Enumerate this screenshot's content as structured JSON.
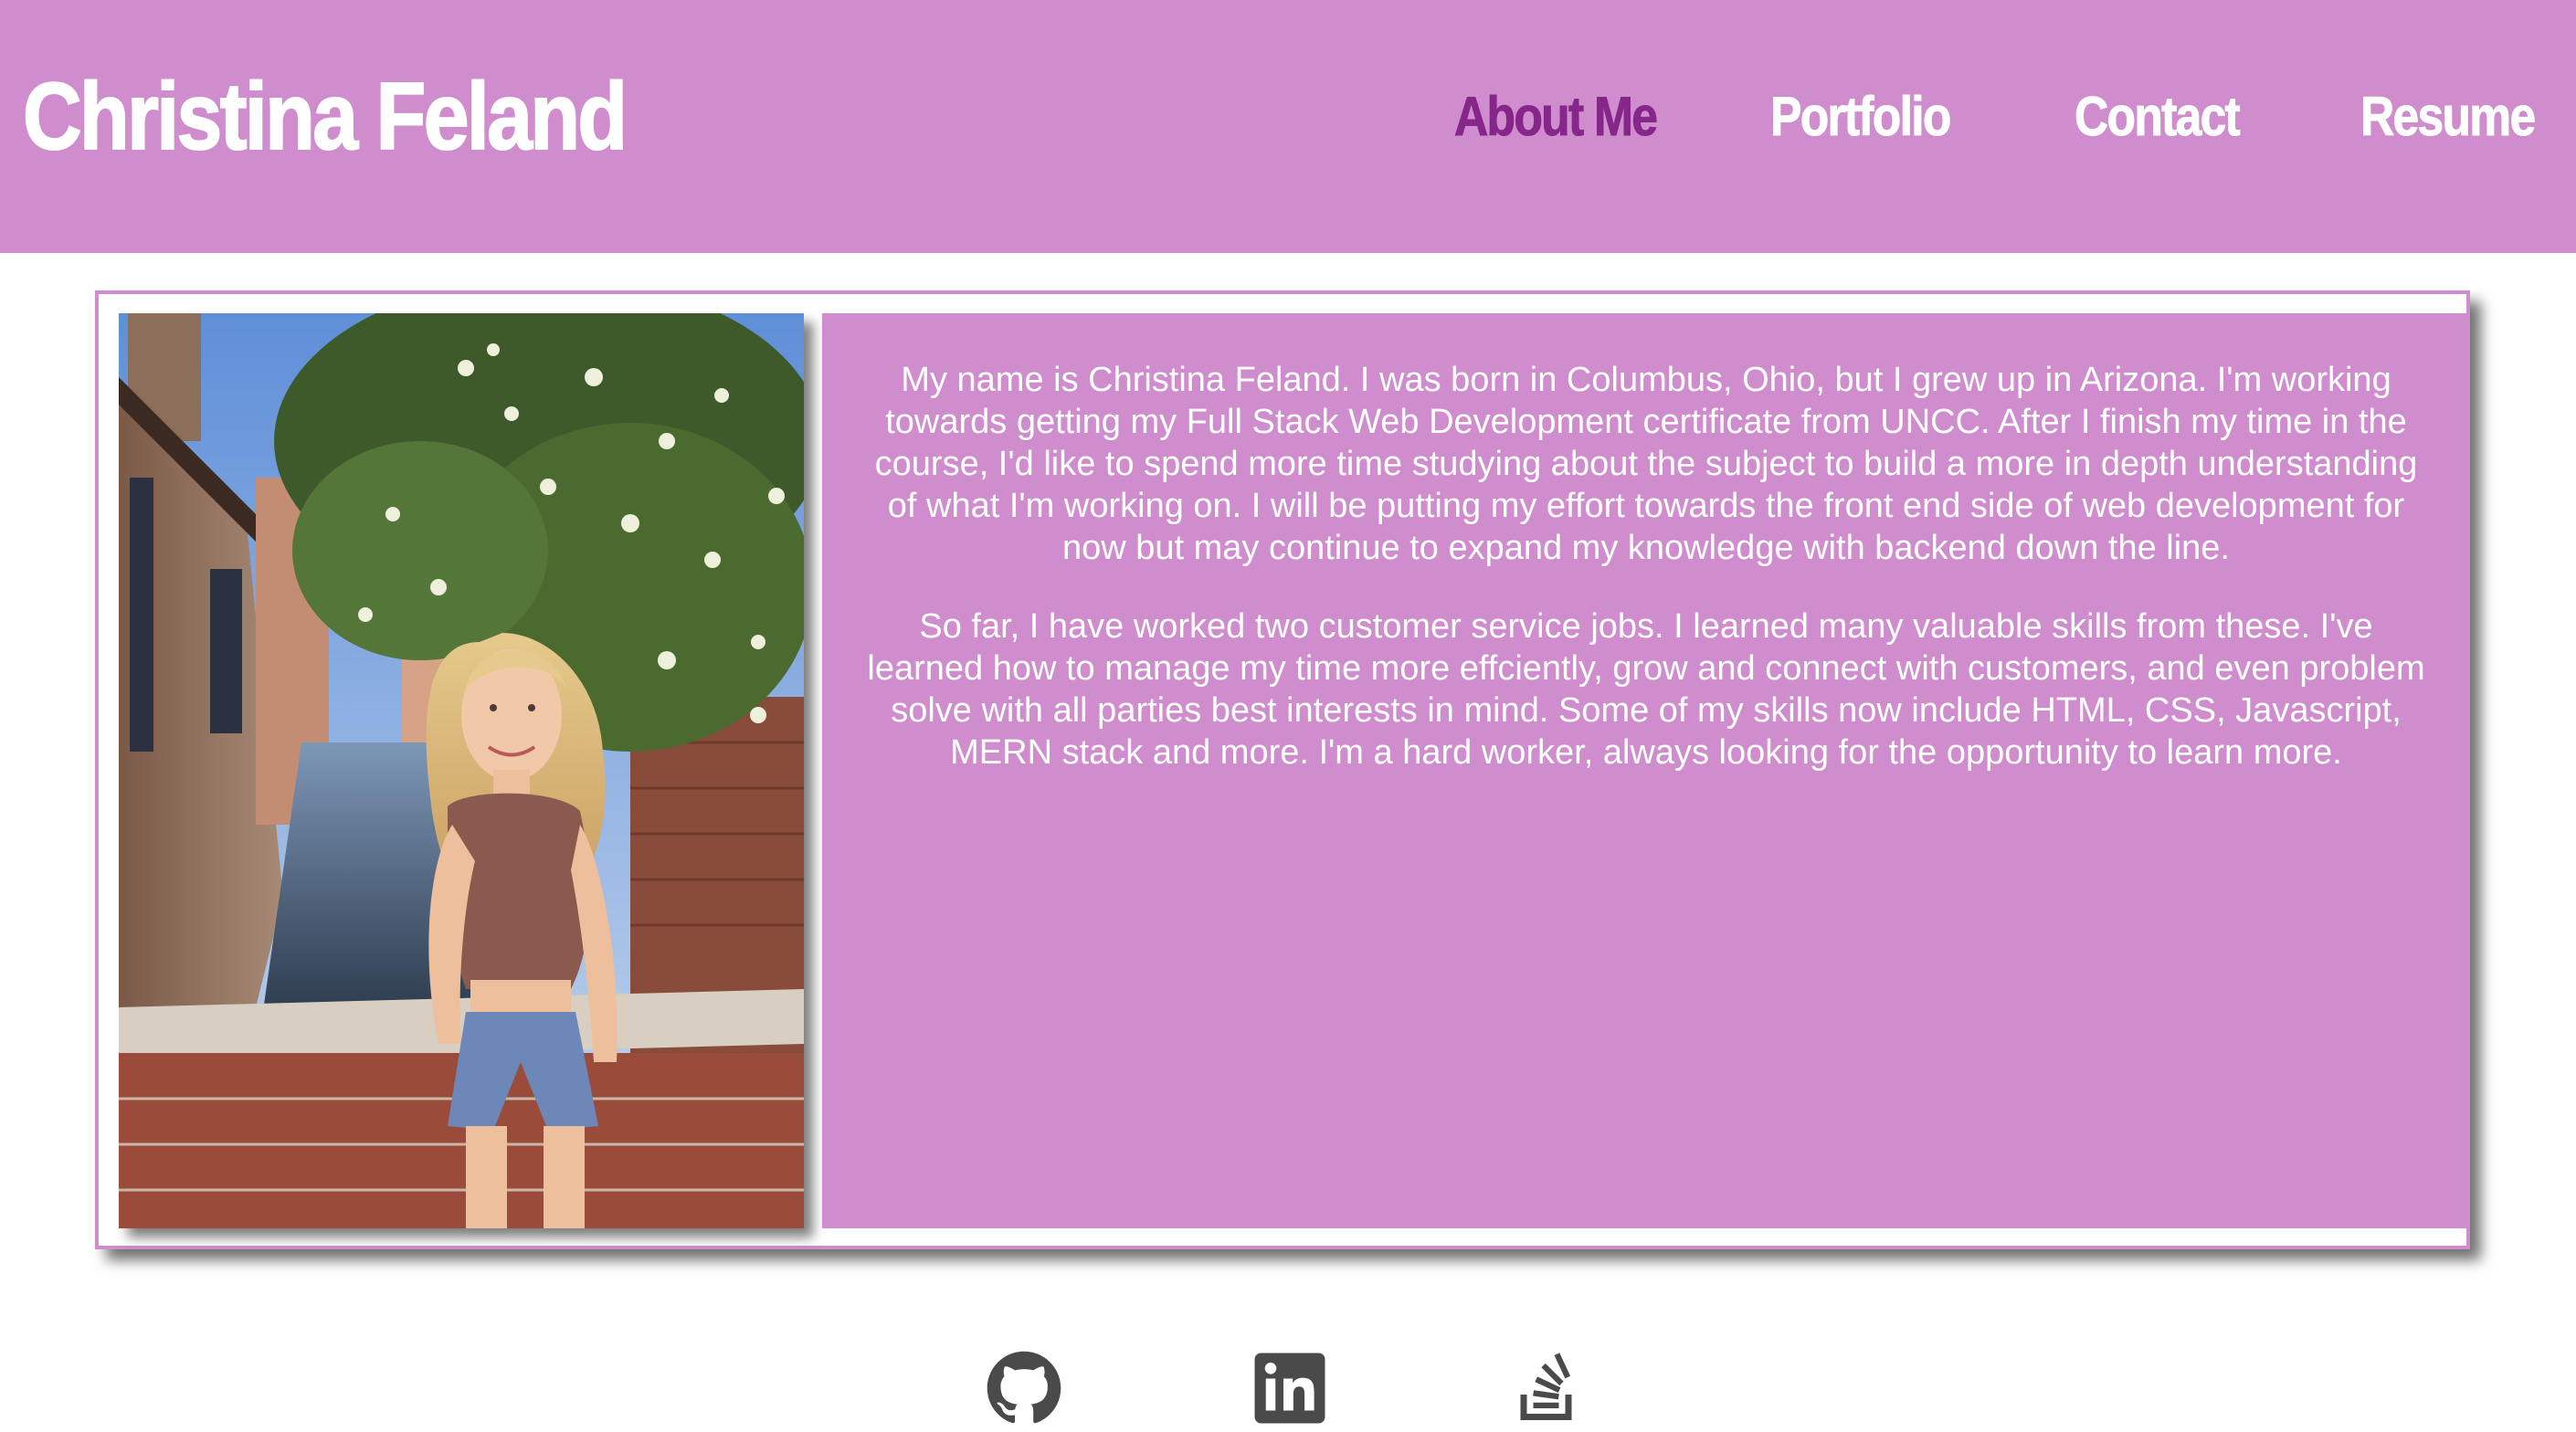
{
  "header": {
    "site_title": "Christina Feland",
    "nav": [
      {
        "label": "About Me",
        "active": true
      },
      {
        "label": "Portfolio",
        "active": false
      },
      {
        "label": "Contact",
        "active": false
      },
      {
        "label": "Resume",
        "active": false
      }
    ]
  },
  "about": {
    "photo_icon": "profile-photo",
    "paragraphs": [
      "My name is Christina Feland. I was born in Columbus, Ohio, but I grew up in Arizona. I'm working towards getting my Full Stack Web Development certificate from UNCC. After I finish my time in the course, I'd like to spend more time studying about the subject to build a more in depth understanding of what I'm working on. I will be putting my effort towards the front end side of web development for now but may continue to expand my knowledge with backend down the line.",
      "So far, I have worked two customer service jobs. I learned many valuable skills from these. I've learned how to manage my time more effciently, grow and connect with customers, and even problem solve with all parties best interests in mind. Some of my skills now include HTML, CSS, Javascript, MERN stack and more. I'm a hard worker, always looking for the opportunity to learn more."
    ]
  },
  "footer": {
    "social_icons": [
      "github-icon",
      "linkedin-icon",
      "stackoverflow-icon"
    ]
  },
  "colors": {
    "brand": "#cf8dce",
    "active_nav": "#86268a",
    "icon": "#4a4a4a",
    "text_on_brand": "#ffffff"
  }
}
